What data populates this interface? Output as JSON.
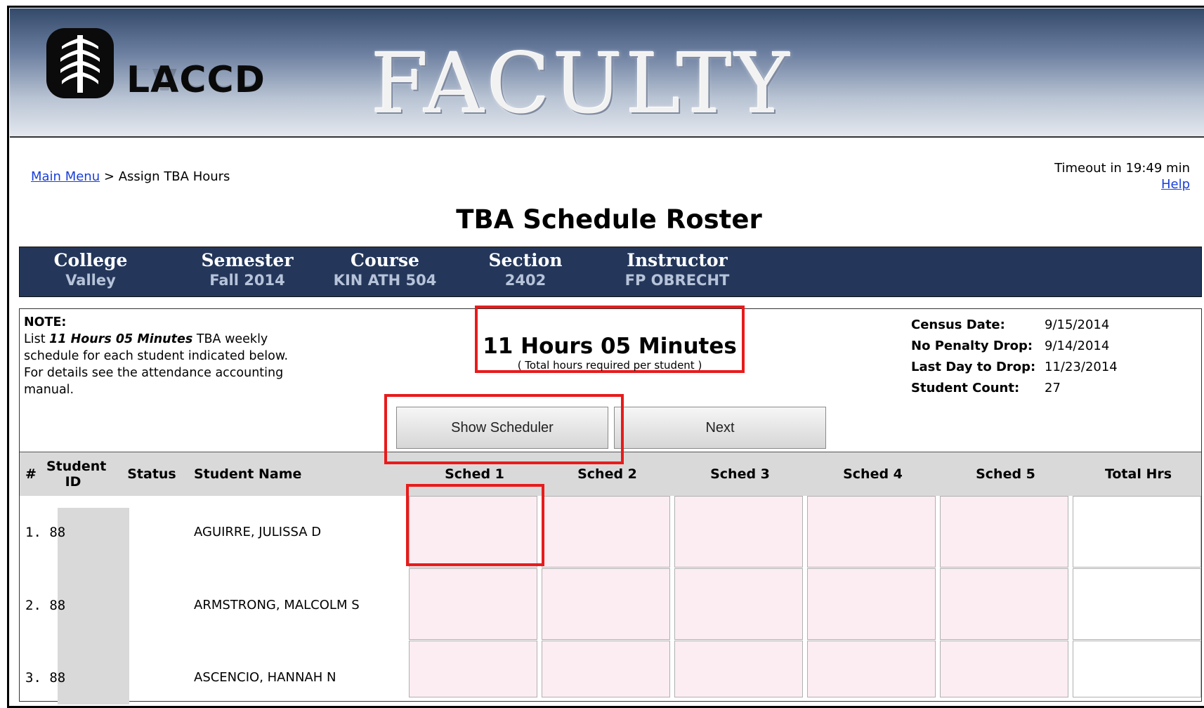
{
  "banner": {
    "logo_text": "LACCD",
    "title": "FACULTY"
  },
  "breadcrumb": {
    "link": "Main Menu",
    "separator": ">",
    "current": "Assign TBA Hours"
  },
  "timeout": {
    "text": "Timeout in 19:49 min",
    "help": "Help"
  },
  "page_title": "TBA Schedule Roster",
  "info": {
    "college": {
      "label": "College",
      "value": "Valley"
    },
    "semester": {
      "label": "Semester",
      "value": "Fall 2014"
    },
    "course": {
      "label": "Course",
      "value": "KIN ATH 504"
    },
    "section": {
      "label": "Section",
      "value": "2402"
    },
    "instructor": {
      "label": "Instructor",
      "value": "FP OBRECHT"
    }
  },
  "note": {
    "heading": "NOTE:",
    "line_prefix": "List ",
    "hours_em": "11 Hours 05 Minutes",
    "line_suffix": " TBA weekly schedule for each student indicated below. For details see the attendance accounting manual."
  },
  "hours": {
    "main": "11 Hours 05 Minutes",
    "sub": "( Total hours required per student )"
  },
  "dates": [
    {
      "label": "Census Date:",
      "value": "9/15/2014"
    },
    {
      "label": "No Penalty Drop:",
      "value": "9/14/2014"
    },
    {
      "label": "Last Day to Drop:",
      "value": "11/23/2014"
    },
    {
      "label": "Student Count:",
      "value": "27"
    }
  ],
  "buttons": {
    "scheduler": "Show Scheduler",
    "next": "Next"
  },
  "table": {
    "headers": {
      "num": "#",
      "student_id_1": "Student",
      "student_id_2": "ID",
      "status": "Status",
      "name": "Student Name",
      "sched1": "Sched 1",
      "sched2": "Sched 2",
      "sched3": "Sched 3",
      "sched4": "Sched 4",
      "sched5": "Sched 5",
      "total": "Total Hrs"
    },
    "rows": [
      {
        "num": "1. 88",
        "name": "AGUIRRE, JULISSA D"
      },
      {
        "num": "2. 88",
        "name": "ARMSTRONG, MALCOLM S"
      },
      {
        "num": "3. 88",
        "name": "ASCENCIO, HANNAH N"
      }
    ]
  }
}
